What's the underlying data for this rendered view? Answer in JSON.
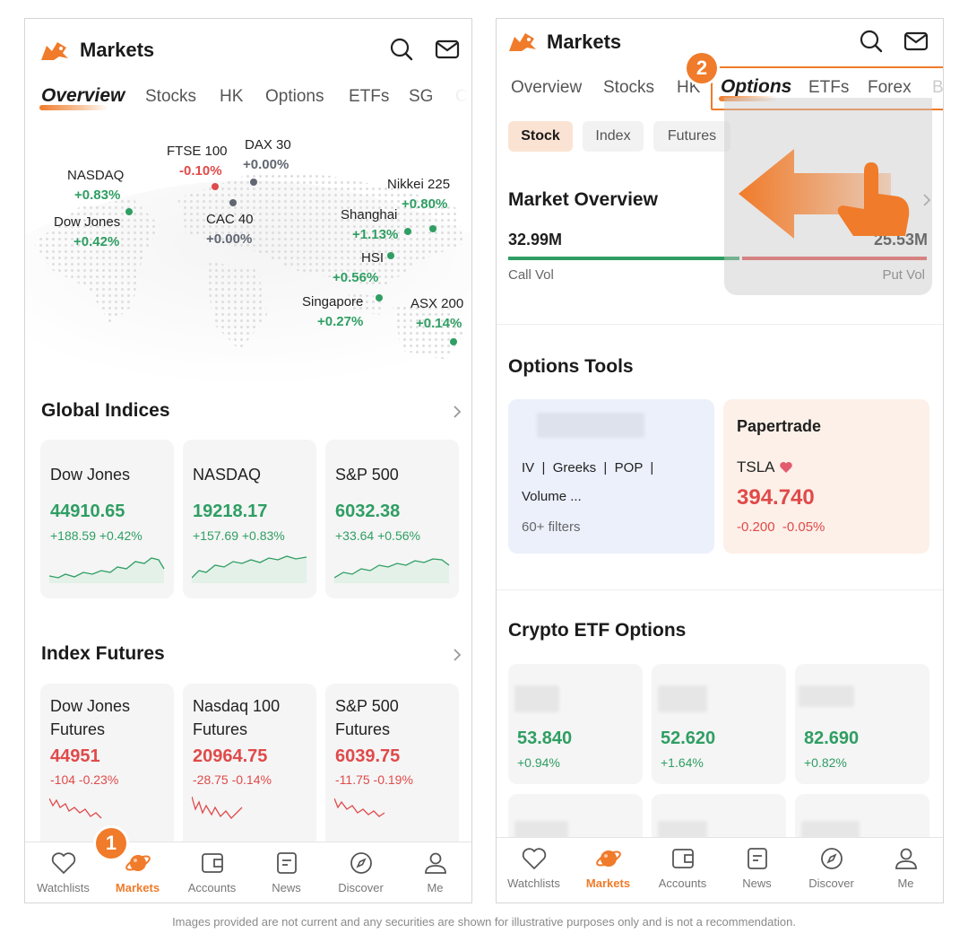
{
  "left": {
    "header": {
      "title": "Markets"
    },
    "tabs": [
      "Overview",
      "Stocks",
      "HK",
      "Options",
      "ETFs",
      "SG",
      "CI"
    ],
    "map_markers": [
      {
        "name": "NASDAQ",
        "change": "+0.83%",
        "color": "#2f9e63"
      },
      {
        "name": "Dow Jones",
        "change": "+0.42%",
        "color": "#2f9e63"
      },
      {
        "name": "FTSE 100",
        "change": "-0.10%",
        "color": "#e04a4a"
      },
      {
        "name": "DAX 30",
        "change": "+0.00%",
        "color": "#606672"
      },
      {
        "name": "CAC 40",
        "change": "+0.00%",
        "color": "#606672"
      },
      {
        "name": "Nikkei 225",
        "change": "+0.80%",
        "color": "#2f9e63"
      },
      {
        "name": "Shanghai",
        "change": "+1.13%",
        "color": "#2f9e63"
      },
      {
        "name": "HSI",
        "change": "+0.56%",
        "color": "#2f9e63"
      },
      {
        "name": "Singapore",
        "change": "+0.27%",
        "color": "#2f9e63"
      },
      {
        "name": "ASX 200",
        "change": "+0.14%",
        "color": "#2f9e63"
      }
    ],
    "global_indices": {
      "title": "Global Indices",
      "cards": [
        {
          "name": "Dow Jones",
          "price": "44910.65",
          "change": "+188.59 +0.42%"
        },
        {
          "name": "NASDAQ",
          "price": "19218.17",
          "change": "+157.69 +0.83%"
        },
        {
          "name": "S&P 500",
          "price": "6032.38",
          "change": "+33.64 +0.56%"
        }
      ]
    },
    "index_futures": {
      "title": "Index Futures",
      "cards": [
        {
          "name": "Dow Jones Futures",
          "price": "44951",
          "change": "-104 -0.23%"
        },
        {
          "name": "Nasdaq 100 Futures",
          "price": "20964.75",
          "change": "-28.75 -0.14%"
        },
        {
          "name": "S&P 500 Futures",
          "price": "6039.75",
          "change": "-11.75 -0.19%"
        }
      ]
    },
    "step_badge": "1"
  },
  "right": {
    "header": {
      "title": "Markets"
    },
    "tabs": [
      "Overview",
      "Stocks",
      "HK",
      "Options",
      "ETFs",
      "Forex",
      "B"
    ],
    "step_badge": "2",
    "chips": [
      "Stock",
      "Index",
      "Futures"
    ],
    "market_overview": {
      "title": "Market Overview",
      "call_value": "32.99M",
      "put_value": "25.53M",
      "call_label": "Call Vol",
      "put_label": "Put Vol"
    },
    "options_tools": {
      "title": "Options Tools",
      "screener": {
        "line1": "IV  |  Greeks  |  POP  |",
        "line2": "Volume ...",
        "filters": "60+ filters"
      },
      "papertrade": {
        "title": "Papertrade",
        "symbol": "TSLA",
        "price": "394.740",
        "change": "-0.200  -0.05%"
      }
    },
    "crypto_etf": {
      "title": "Crypto ETF Options",
      "cards": [
        {
          "price": "53.840",
          "change": "+0.94%"
        },
        {
          "price": "52.620",
          "change": "+1.64%"
        },
        {
          "price": "82.690",
          "change": "+0.82%"
        }
      ]
    }
  },
  "bottom_nav": [
    "Watchlists",
    "Markets",
    "Accounts",
    "News",
    "Discover",
    "Me"
  ],
  "footnote": "Images provided are not current and any securities are shown for illustrative purposes only and is not a recommendation.",
  "colors": {
    "accent": "#f07b2a",
    "up": "#2f9e63",
    "down": "#e04a4a"
  }
}
